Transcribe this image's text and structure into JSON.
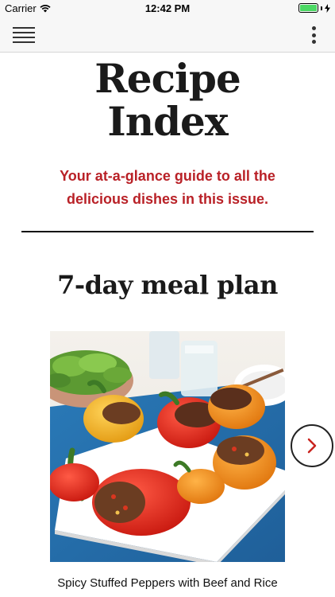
{
  "status_bar": {
    "carrier": "Carrier",
    "time": "12:42 PM",
    "battery_level": 1.0,
    "battery_color": "#4cd964",
    "icons": [
      "wifi-icon",
      "battery-icon",
      "charging-bolt-icon"
    ]
  },
  "nav": {
    "menu_icon": "hamburger-menu-icon",
    "more_icon": "vertical-ellipsis-icon"
  },
  "page": {
    "title_line1": "Recipe",
    "title_line2": "Index",
    "subtitle": "Your at-a-glance guide to all the delicious dishes in this issue.",
    "accent_color": "#b92127"
  },
  "section": {
    "title": "7-day meal plan"
  },
  "carousel": {
    "current_item": {
      "image_label": "stuffed-peppers-photo",
      "caption": "Spicy Stuffed Peppers with Beef and Rice"
    },
    "next_icon": "chevron-right-icon"
  }
}
